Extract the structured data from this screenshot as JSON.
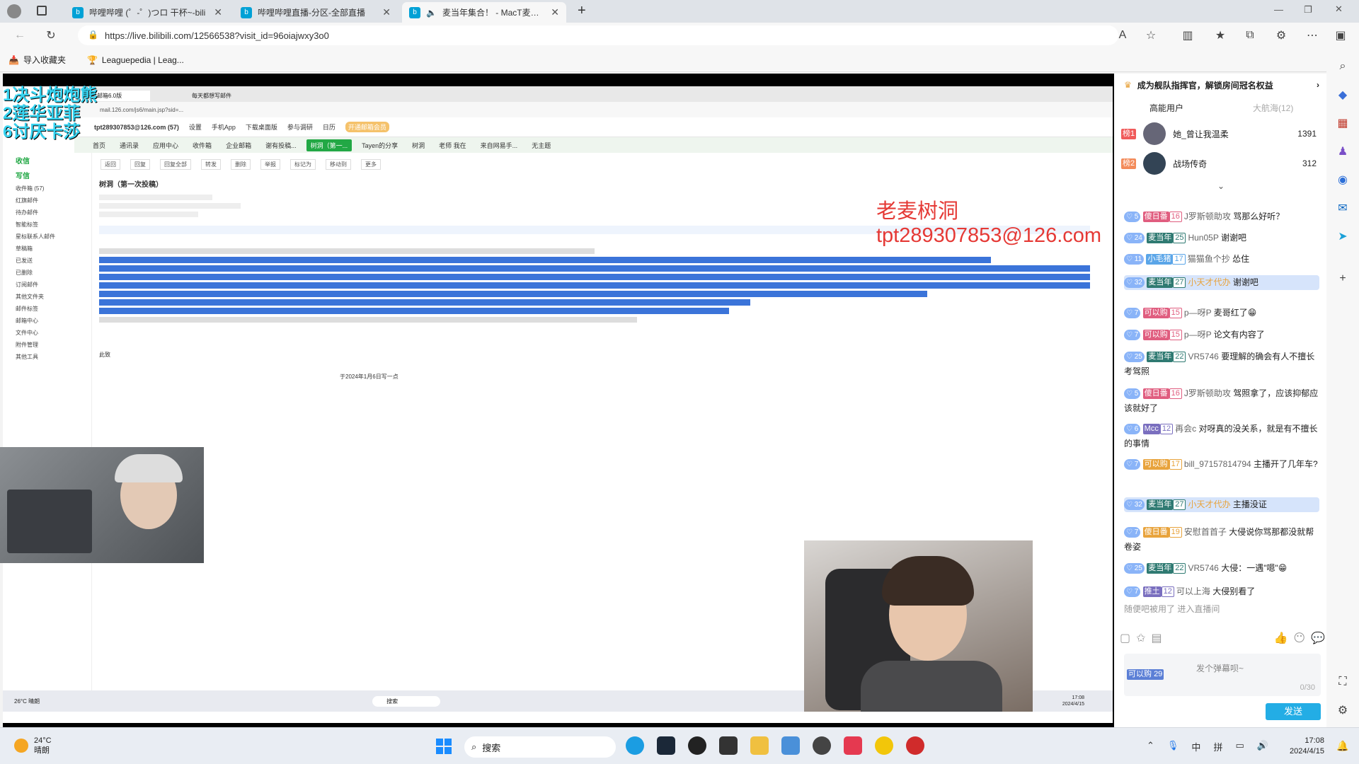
{
  "browser": {
    "tabs": [
      {
        "title": "哔哩哔哩 (゜-゜)つロ 干杯~-bili",
        "active": false
      },
      {
        "title": "哔哩哔哩直播-分区-全部直播",
        "active": false
      },
      {
        "title": "麦当年集合！ - MacT麦克雷",
        "active": true
      }
    ],
    "url": "https://live.bilibili.com/12566538?visit_id=96oiajwxy3o0",
    "favorites": [
      "导入收藏夹",
      "Leaguepedia | Leag..."
    ]
  },
  "stream": {
    "overlay_lines": [
      "1决斗炮炮熊",
      "2莲华亚菲",
      "6讨厌卡莎"
    ],
    "watermark_lines": [
      "老麦树洞",
      "tpt289307853@126.com"
    ],
    "inner_browser": {
      "tabs": [
        "网易邮箱6.0版",
        "每天都想写邮件"
      ],
      "url": "mail.126.com/js6/main.jsp?sid=...",
      "account": "tpt289307853@126.com (57)",
      "header_links": [
        "设置",
        "手机App",
        "下载桌面版",
        "参与调研",
        "日历",
        "开通邮箱会员"
      ],
      "mail_tabs": [
        {
          "label": "首页",
          "on": false
        },
        {
          "label": "通讯录",
          "on": false
        },
        {
          "label": "应用中心",
          "on": false
        },
        {
          "label": "收件箱",
          "on": false
        },
        {
          "label": "企业邮箱",
          "on": false
        },
        {
          "label": "谢有投稿...",
          "on": false
        },
        {
          "label": "树洞（第一...",
          "on": true
        },
        {
          "label": "Tayen的分享",
          "on": false
        },
        {
          "label": "树洞",
          "on": false
        },
        {
          "label": "老师 我在",
          "on": false
        },
        {
          "label": "来自网易手...",
          "on": false
        },
        {
          "label": "无主题",
          "on": false
        }
      ],
      "side": [
        "收信",
        "写信",
        "收件箱 (57)",
        "红旗邮件",
        "待办邮件",
        "智能标签",
        "星标联系人邮件",
        "草稿箱",
        "已发送",
        "已删除",
        "订阅邮件",
        "其他文件夹",
        "邮件标签",
        "邮箱中心",
        "文件中心",
        "附件管理",
        "其他工具"
      ],
      "toolbar": [
        "返回",
        "回复",
        "回复全部",
        "转发",
        "删除",
        "举报",
        "标记为",
        "移动到",
        "更多"
      ],
      "mail_subject": "树洞（第一次投稿）",
      "mail_footer": "此致",
      "mail_date": "于2024年1月6日写一点"
    }
  },
  "panel": {
    "promo": "成为舰队指挥官，解锁房间冠名权益",
    "tab_high": "高能用户",
    "tab_guard": "大航海(12)",
    "ranks": [
      {
        "rank": "榜1",
        "name": "她_曾让我温柔",
        "score": "1391"
      },
      {
        "rank": "榜2",
        "name": "战场传奇",
        "score": "312"
      }
    ],
    "danmaku": [
      {
        "lvl": "5",
        "medal": "傻日番",
        "mlv": "16",
        "user": "J罗斯顿助攻",
        "text": "骂那么好听？",
        "color": "#e05d7f",
        "hl": false
      },
      {
        "lvl": "24",
        "medal": "麦当年",
        "mlv": "25",
        "user": "Hun05P",
        "text": "谢谢吧",
        "color": "#2f7a72",
        "hl": false
      },
      {
        "lvl": "11",
        "medal": "小毛猪",
        "mlv": "17",
        "user": "猫猫鱼个抄",
        "text": "怂住",
        "color": "#5aa5e8",
        "hl": false
      },
      {
        "lvl": "32",
        "medal": "麦当年",
        "mlv": "27",
        "user": "小天才代办",
        "text": "谢谢吧",
        "color": "#2f7a72",
        "hl": true
      },
      {
        "lvl": "7",
        "medal": "可以购",
        "mlv": "15",
        "user": "p—呀P",
        "text": "麦哥红了😁",
        "color": "#e05d7f",
        "hl": false
      },
      {
        "lvl": "7",
        "medal": "可以购",
        "mlv": "15",
        "user": "p—呀P",
        "text": "论文有内容了",
        "color": "#e05d7f",
        "hl": false
      },
      {
        "lvl": "25",
        "medal": "麦当年",
        "mlv": "22",
        "user": "VR5746",
        "text": "要理解的确会有人不擅长考驾照",
        "color": "#2f7a72",
        "hl": false
      },
      {
        "lvl": "5",
        "medal": "傻日番",
        "mlv": "16",
        "user": "J罗斯顿助攻",
        "text": "驾照拿了，应该抑郁应该就好了",
        "color": "#e05d7f",
        "hl": false
      },
      {
        "lvl": "6",
        "medal": "Mcc",
        "mlv": "12",
        "user": "再会c",
        "text": "对呀真的没关系，就是有不擅长的事情",
        "color": "#7a6fbf",
        "hl": false
      },
      {
        "lvl": "7",
        "medal": "可以购",
        "mlv": "17",
        "user": "bill_97157814794",
        "text": "主播开了几年车?",
        "color": "#e8a33c",
        "hl": false
      },
      {
        "lvl": "32",
        "medal": "麦当年",
        "mlv": "27",
        "user": "小天才代办",
        "text": "主播没证",
        "color": "#2f7a72",
        "hl": true
      },
      {
        "lvl": "7",
        "medal": "傻日番",
        "mlv": "19",
        "user": "安慰首首子",
        "text": "大侵说你骂那都没就帮卷姿",
        "color": "#e8a33c",
        "hl": false
      },
      {
        "lvl": "25",
        "medal": "麦当年",
        "mlv": "22",
        "user": "VR5746",
        "text": "大侵：一遇\"嗯\"😁",
        "color": "#2f7a72",
        "hl": false
      },
      {
        "lvl": "7",
        "medal": "推土",
        "mlv": "12",
        "user": "可以上海",
        "text": "大侵别看了",
        "color": "#7a6fbf",
        "hl": false
      }
    ],
    "enter_notice": "随便吧被用了 进入直播间",
    "input_placeholder": "发个弹幕呗~",
    "input_count": "0/30",
    "medal_self": "可以购",
    "medal_self_lvl": "29",
    "send_label": "发送"
  },
  "taskbar": {
    "weather_temp": "24°C",
    "weather_desc": "晴朗",
    "search_label": "搜索",
    "time": "17:08",
    "date": "2024/4/15",
    "ime": "中",
    "ime2": "拼"
  },
  "inner_taskbar": {
    "temp": "26°C",
    "desc": "晴朗",
    "search": "搜索",
    "time": "17:08",
    "date": "2024/4/15"
  },
  "colors": {
    "bili_blue": "#00a1d6",
    "send_btn": "#23ade5",
    "mail_green": "#22a845"
  }
}
